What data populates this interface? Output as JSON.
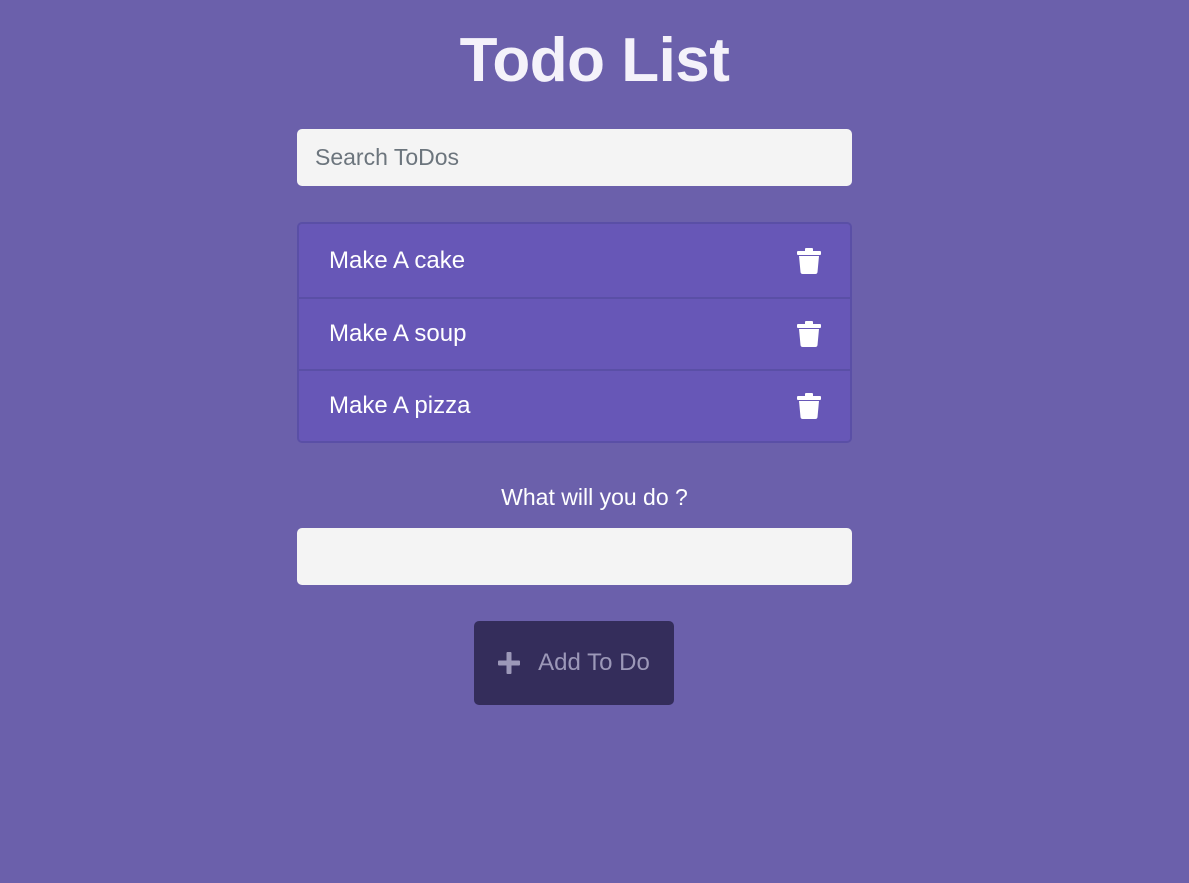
{
  "header": {
    "title": "Todo List"
  },
  "search": {
    "placeholder": "Search ToDos",
    "value": ""
  },
  "todos": [
    {
      "text": "Make A cake",
      "icon": "trash-icon"
    },
    {
      "text": "Make A soup",
      "icon": "trash-icon"
    },
    {
      "text": "Make A pizza",
      "icon": "trash-icon"
    }
  ],
  "add_form": {
    "label": "What will you do ?",
    "value": "",
    "button_label": "Add To Do",
    "button_icon": "plus-icon"
  },
  "colors": {
    "background": "#6b60ab",
    "list_item": "#6757b7",
    "button": "#342d5b",
    "input": "#f4f4f4"
  }
}
